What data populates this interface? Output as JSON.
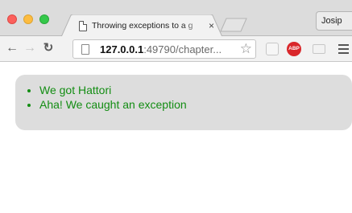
{
  "browser": {
    "tab_title": "Throwing exceptions to a g",
    "tab_close_glyph": "×",
    "profile_name": "Josip",
    "url_host": "127.0.0.1",
    "url_rest": ":49790/chapter...",
    "bookmark_glyph": "☆",
    "abp_label": "ABP"
  },
  "page": {
    "results": [
      {
        "text": "We got Hattori",
        "color": "#138d13"
      },
      {
        "text": "Aha! We caught an exception",
        "color": "#138d13"
      }
    ],
    "panel_color": "#dddddd"
  }
}
